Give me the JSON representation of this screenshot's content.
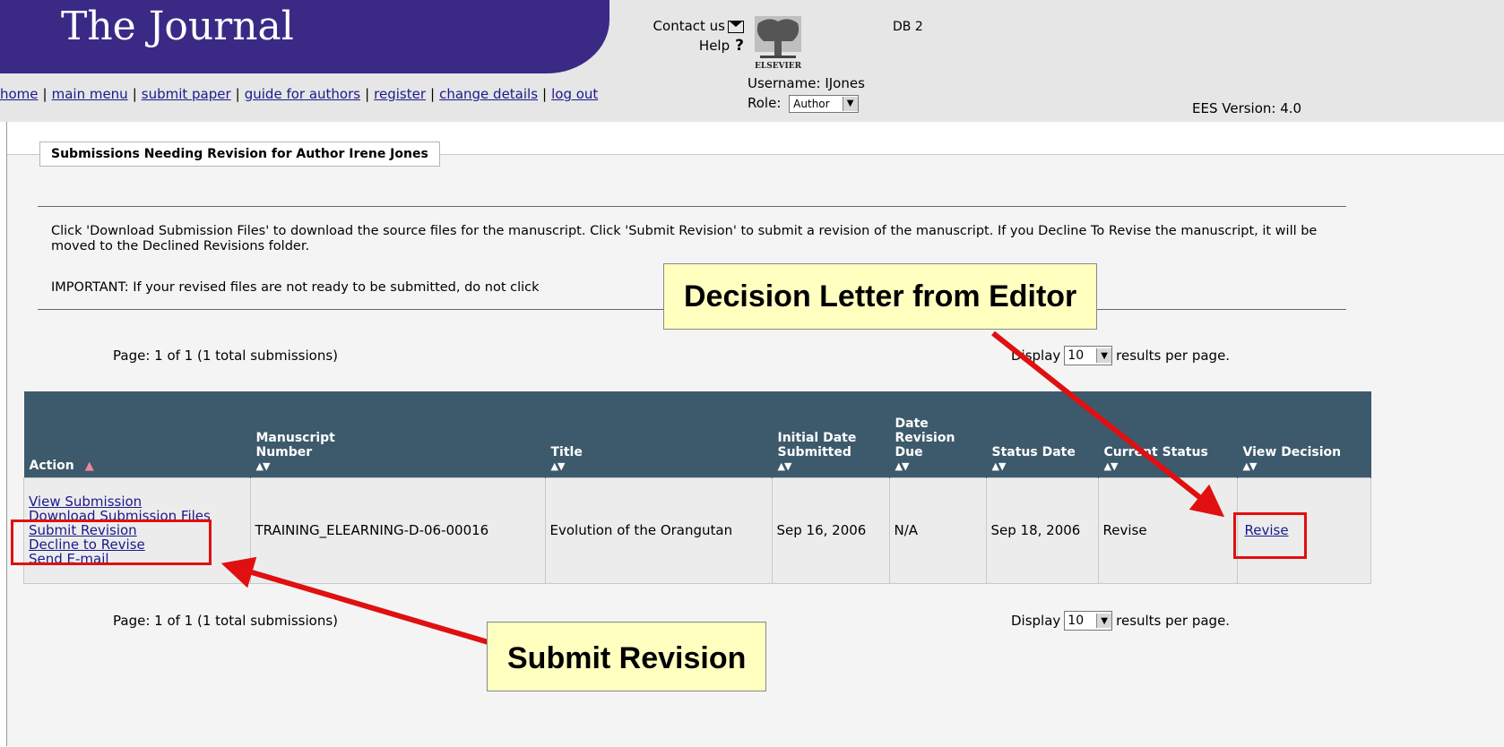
{
  "header": {
    "journal_title": "The Journal",
    "contact_label": "Contact us",
    "help_label": "Help",
    "logo_text": "ELSEVIER",
    "db_label": "DB 2",
    "username_label": "Username:",
    "username": "IJones",
    "role_label": "Role:",
    "role_value": "Author",
    "version": "EES Version: 4.0"
  },
  "nav": [
    "home",
    "main menu",
    "submit paper",
    "guide for authors",
    "register",
    "change details",
    "log out"
  ],
  "section": {
    "title": "Submissions Needing Revision for Author Irene Jones",
    "instructions": "Click 'Download Submission Files' to download the source files for the manuscript. Click 'Submit Revision' to submit a revision of the manuscript. If you Decline To Revise the manuscript, it will be moved to the Declined Revisions folder.",
    "important": "IMPORTANT: If your revised files are not ready to be submitted, do not click"
  },
  "pager": {
    "text": "Page: 1 of 1 (1 total submissions)",
    "display_label": "Display",
    "per_page": "10",
    "results_label": "results per page."
  },
  "table": {
    "headers": [
      "Action",
      "Manuscript Number",
      "Title",
      "Initial Date Submitted",
      "Date Revision Due",
      "Status Date",
      "Current Status",
      "View Decision"
    ],
    "actions": [
      "View Submission",
      "Download Submission Files",
      "Submit Revision",
      "Decline to Revise",
      "Send E-mail"
    ],
    "row": {
      "manuscript": "TRAINING_ELEARNING-D-06-00016",
      "title": "Evolution of the Orangutan",
      "initial_date": "Sep 16, 2006",
      "revision_due": "N/A",
      "status_date": "Sep 18, 2006",
      "current_status": "Revise",
      "view_decision": "Revise"
    }
  },
  "callouts": {
    "decision": "Decision Letter from Editor",
    "submit": "Submit Revision"
  },
  "colors": {
    "banner": "#3a2a86",
    "table_header": "#3d5a6c",
    "highlight": "#e01010",
    "callout_bg": "#ffffc0"
  }
}
